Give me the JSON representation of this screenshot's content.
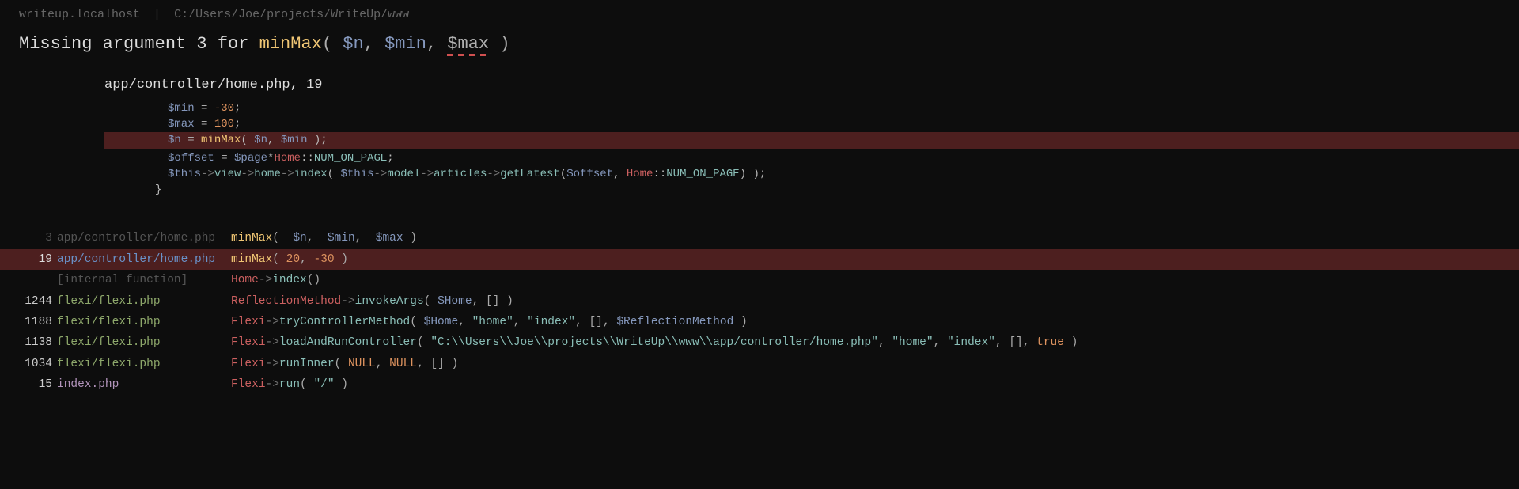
{
  "breadcrumb": {
    "host": "writeup.localhost",
    "path": "C:/Users/Joe/projects/WriteUp/www"
  },
  "error": {
    "prefix": "Missing argument 3 for ",
    "fn": "minMax",
    "args": [
      "$n",
      "$min",
      "$max"
    ],
    "missingIndex": 2
  },
  "source": {
    "file": "app/controller/home.php",
    "line": "19",
    "lines": [
      {
        "html": "<span class=\"var\">$min</span> <span class=\"op\">=</span> <span class=\"num\">-30</span>;"
      },
      {
        "html": "<span class=\"var\">$max</span> <span class=\"op\">=</span> <span class=\"num\">100</span>;"
      },
      {
        "hl": true,
        "html": "<span class=\"var\">$n</span> <span class=\"op\">=</span> <span class=\"fn\">minMax</span>( <span class=\"var\">$n</span>, <span class=\"var\">$min</span> );"
      },
      {
        "html": ""
      },
      {
        "html": "<span class=\"var\">$offset</span> <span class=\"op\">=</span> <span class=\"var\">$page</span><span class=\"op\">*</span><span class=\"cls\">Home</span>::<span class=\"const\">NUM_ON_PAGE</span>;"
      },
      {
        "html": "<span class=\"var\">$this</span><span class=\"arrow\">-&gt;</span><span class=\"method\">view</span><span class=\"arrow\">-&gt;</span><span class=\"method\">home</span><span class=\"arrow\">-&gt;</span><span class=\"method\">index</span>( <span class=\"var\">$this</span><span class=\"arrow\">-&gt;</span><span class=\"method\">model</span><span class=\"arrow\">-&gt;</span><span class=\"method\">articles</span><span class=\"arrow\">-&gt;</span><span class=\"method\">getLatest</span>(<span class=\"var\">$offset</span>, <span class=\"cls\">Home</span>::<span class=\"const\">NUM_ON_PAGE</span>) );"
      },
      {
        "closeBrace": true,
        "html": "}"
      }
    ]
  },
  "stack": [
    {
      "line": "3",
      "file": "app/controller/home.php",
      "dim": true,
      "call": "<span class=\"fn\">minMax</span><span class=\"p\">(</span>  <span class=\"var\">$n</span><span class=\"p\">,</span>  <span class=\"var\">$min</span><span class=\"p\">,</span>  <span class=\"var\">$max</span> <span class=\"p\">)</span>"
    },
    {
      "line": "19",
      "file": "app/controller/home.php",
      "hl": true,
      "call": "<span class=\"fn\">minMax</span><span class=\"p\">(</span> <span class=\"num\">20</span><span class=\"p\">,</span> <span class=\"num\">-30</span> <span class=\"p\">)</span>"
    },
    {
      "line": "",
      "file": "[internal function]",
      "dim": true,
      "call": "<span class=\"cls\">Home</span><span class=\"arrow\">-&gt;</span><span class=\"method\">index</span><span class=\"p\">()</span>"
    },
    {
      "line": "1244",
      "file": "flexi/flexi.php",
      "call": "<span class=\"cls\">ReflectionMethod</span><span class=\"arrow\">-&gt;</span><span class=\"method\">invokeArgs</span><span class=\"p\">(</span> <span class=\"var\">$Home</span><span class=\"p\">,</span> <span class=\"p\">[] )</span>"
    },
    {
      "line": "1188",
      "file": "flexi/flexi.php",
      "call": "<span class=\"cls\">Flexi</span><span class=\"arrow\">-&gt;</span><span class=\"method\">tryControllerMethod</span><span class=\"p\">(</span> <span class=\"var\">$Home</span><span class=\"p\">,</span> <span class=\"str\">\"home\"</span><span class=\"p\">,</span> <span class=\"str\">\"index\"</span><span class=\"p\">,</span> <span class=\"p\">[]</span><span class=\"p\">,</span> <span class=\"var\">$ReflectionMethod</span> <span class=\"p\">)</span>"
    },
    {
      "line": "1138",
      "file": "flexi/flexi.php",
      "call": "<span class=\"cls\">Flexi</span><span class=\"arrow\">-&gt;</span><span class=\"method\">loadAndRunController</span><span class=\"p\">(</span> <span class=\"str\">\"C:\\\\Users\\\\Joe\\\\projects\\\\WriteUp\\\\www\\\\app/controller/home.php\"</span><span class=\"p\">,</span> <span class=\"str\">\"home\"</span><span class=\"p\">,</span> <span class=\"str\">\"index\"</span><span class=\"p\">,</span> <span class=\"p\">[]</span><span class=\"p\">,</span> <span class=\"lit\">true</span> <span class=\"p\">)</span>"
    },
    {
      "line": "1034",
      "file": "flexi/flexi.php",
      "call": "<span class=\"cls\">Flexi</span><span class=\"arrow\">-&gt;</span><span class=\"method\">runInner</span><span class=\"p\">(</span> <span class=\"lit\">NULL</span><span class=\"p\">,</span> <span class=\"lit\">NULL</span><span class=\"p\">,</span> <span class=\"p\">[] )</span>"
    },
    {
      "line": "15",
      "file": "index.php",
      "fileClass": "idx",
      "call": "<span class=\"cls\">Flexi</span><span class=\"arrow\">-&gt;</span><span class=\"method\">run</span><span class=\"p\">(</span> <span class=\"str\">\"/\"</span> <span class=\"p\">)</span>"
    }
  ]
}
